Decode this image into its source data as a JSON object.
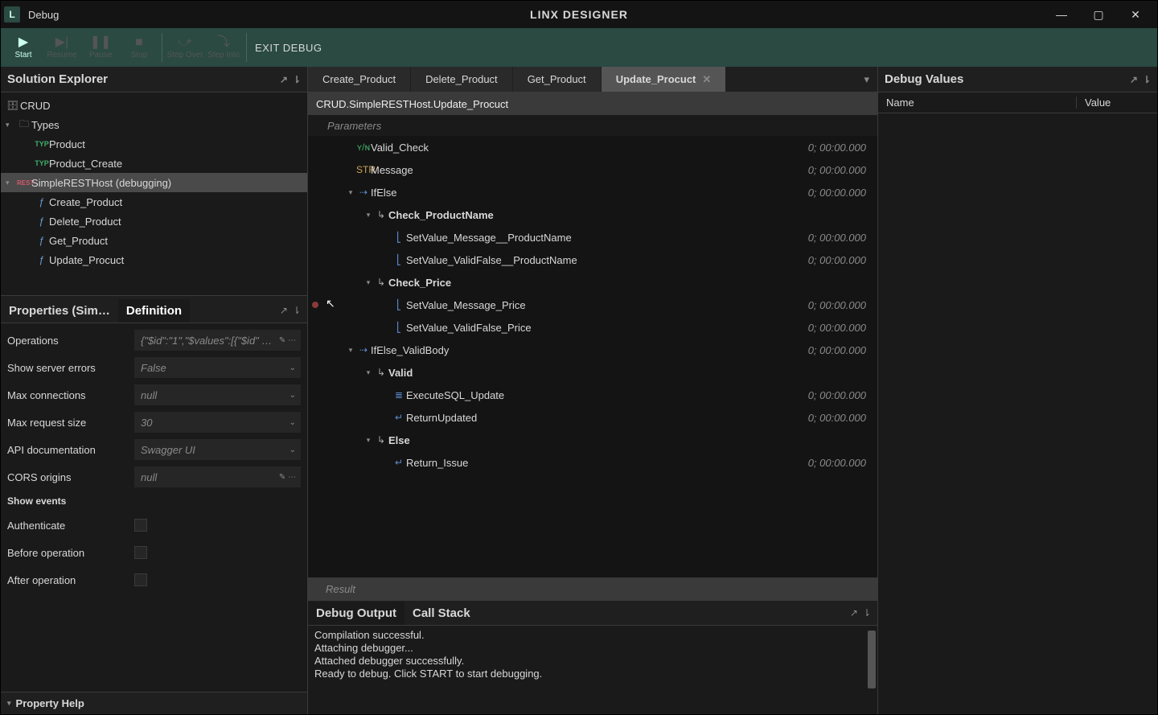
{
  "window": {
    "menu_debug": "Debug",
    "center_title": "LINX DESIGNER"
  },
  "toolbar": {
    "start": "Start",
    "resume": "Resume",
    "pause": "Pause",
    "stop": "Stop",
    "step_over": "Step Over",
    "step_into": "Step Into",
    "exit_debug": "EXIT DEBUG"
  },
  "solution": {
    "title": "Solution Explorer",
    "root": "CRUD",
    "types": "Types",
    "type_items": [
      "Product",
      "Product_Create"
    ],
    "rest_host": "SimpleRESTHost (debugging)",
    "functions": [
      "Create_Product",
      "Delete_Product",
      "Get_Product",
      "Update_Procuct"
    ]
  },
  "props": {
    "tab_props": "Properties (Sim…",
    "tab_def": "Definition",
    "rows": [
      {
        "label": "Operations",
        "value": "{\"$id\":\"1\",\"$values\":[{\"$id\"  …",
        "type": "edit"
      },
      {
        "label": "Show server errors",
        "value": "False",
        "type": "select"
      },
      {
        "label": "Max connections",
        "value": "null",
        "type": "select"
      },
      {
        "label": "Max request size",
        "value": "30",
        "type": "select"
      },
      {
        "label": "API documentation",
        "value": "Swagger UI",
        "type": "select"
      },
      {
        "label": "CORS origins",
        "value": "null",
        "type": "edit"
      }
    ],
    "events_header": "Show events",
    "events": [
      {
        "label": "Authenticate"
      },
      {
        "label": "Before operation"
      },
      {
        "label": "After operation"
      }
    ],
    "help": "Property Help"
  },
  "editor": {
    "tabs": [
      "Create_Product",
      "Delete_Product",
      "Get_Product",
      "Update_Procuct"
    ],
    "active_index": 3,
    "breadcrumb": "CRUD.SimpleRESTHost.Update_Procuct",
    "parameters_label": "Parameters",
    "flow": [
      {
        "d": 1,
        "arrow": "",
        "ico": "var",
        "icoTxt": "ʏ/ɴ",
        "name": "Valid_Check",
        "time": "0; 00:00.000"
      },
      {
        "d": 1,
        "arrow": "",
        "ico": "str",
        "icoTxt": "STR",
        "name": "Message",
        "time": "0; 00:00.000"
      },
      {
        "d": 1,
        "arrow": "▾",
        "ico": "cond",
        "icoTxt": "⇢",
        "name": "IfElse",
        "time": "0; 00:00.000"
      },
      {
        "d": 2,
        "arrow": "▾",
        "ico": "branch",
        "icoTxt": "↳",
        "name": "Check_ProductName",
        "bold": true,
        "time": ""
      },
      {
        "d": 3,
        "arrow": "",
        "ico": "set",
        "icoTxt": "⎣",
        "name": "SetValue_Message__ProductName",
        "time": "0; 00:00.000"
      },
      {
        "d": 3,
        "arrow": "",
        "ico": "set",
        "icoTxt": "⎣",
        "name": "SetValue_ValidFalse__ProductName",
        "time": "0; 00:00.000"
      },
      {
        "d": 2,
        "arrow": "▾",
        "ico": "branch",
        "icoTxt": "↳",
        "name": "Check_Price",
        "bold": true,
        "time": ""
      },
      {
        "d": 3,
        "arrow": "",
        "ico": "set",
        "icoTxt": "⎣",
        "name": "SetValue_Message_Price",
        "time": "0; 00:00.000",
        "bp": true
      },
      {
        "d": 3,
        "arrow": "",
        "ico": "set",
        "icoTxt": "⎣",
        "name": "SetValue_ValidFalse_Price",
        "time": "0; 00:00.000"
      },
      {
        "d": 1,
        "arrow": "▾",
        "ico": "cond",
        "icoTxt": "⇢",
        "name": "IfElse_ValidBody",
        "time": "0; 00:00.000"
      },
      {
        "d": 2,
        "arrow": "▾",
        "ico": "branch",
        "icoTxt": "↳",
        "name": "Valid",
        "bold": true,
        "time": ""
      },
      {
        "d": 3,
        "arrow": "",
        "ico": "db",
        "icoTxt": "≣",
        "name": "ExecuteSQL_Update",
        "time": "0; 00:00.000"
      },
      {
        "d": 3,
        "arrow": "",
        "ico": "ret",
        "icoTxt": "↵",
        "name": "ReturnUpdated",
        "time": "0; 00:00.000"
      },
      {
        "d": 2,
        "arrow": "▾",
        "ico": "branch",
        "icoTxt": "↳",
        "name": "Else",
        "bold": true,
        "time": ""
      },
      {
        "d": 3,
        "arrow": "",
        "ico": "ret",
        "icoTxt": "↵",
        "name": "Return_Issue",
        "time": "0; 00:00.000"
      }
    ],
    "result": "Result"
  },
  "bottom": {
    "tab_output": "Debug Output",
    "tab_callstack": "Call Stack",
    "text": "Compilation successful.\nAttaching debugger...\nAttached debugger successfully.\nReady to debug. Click START to start debugging."
  },
  "debug_values": {
    "title": "Debug Values",
    "col_name": "Name",
    "col_value": "Value"
  }
}
